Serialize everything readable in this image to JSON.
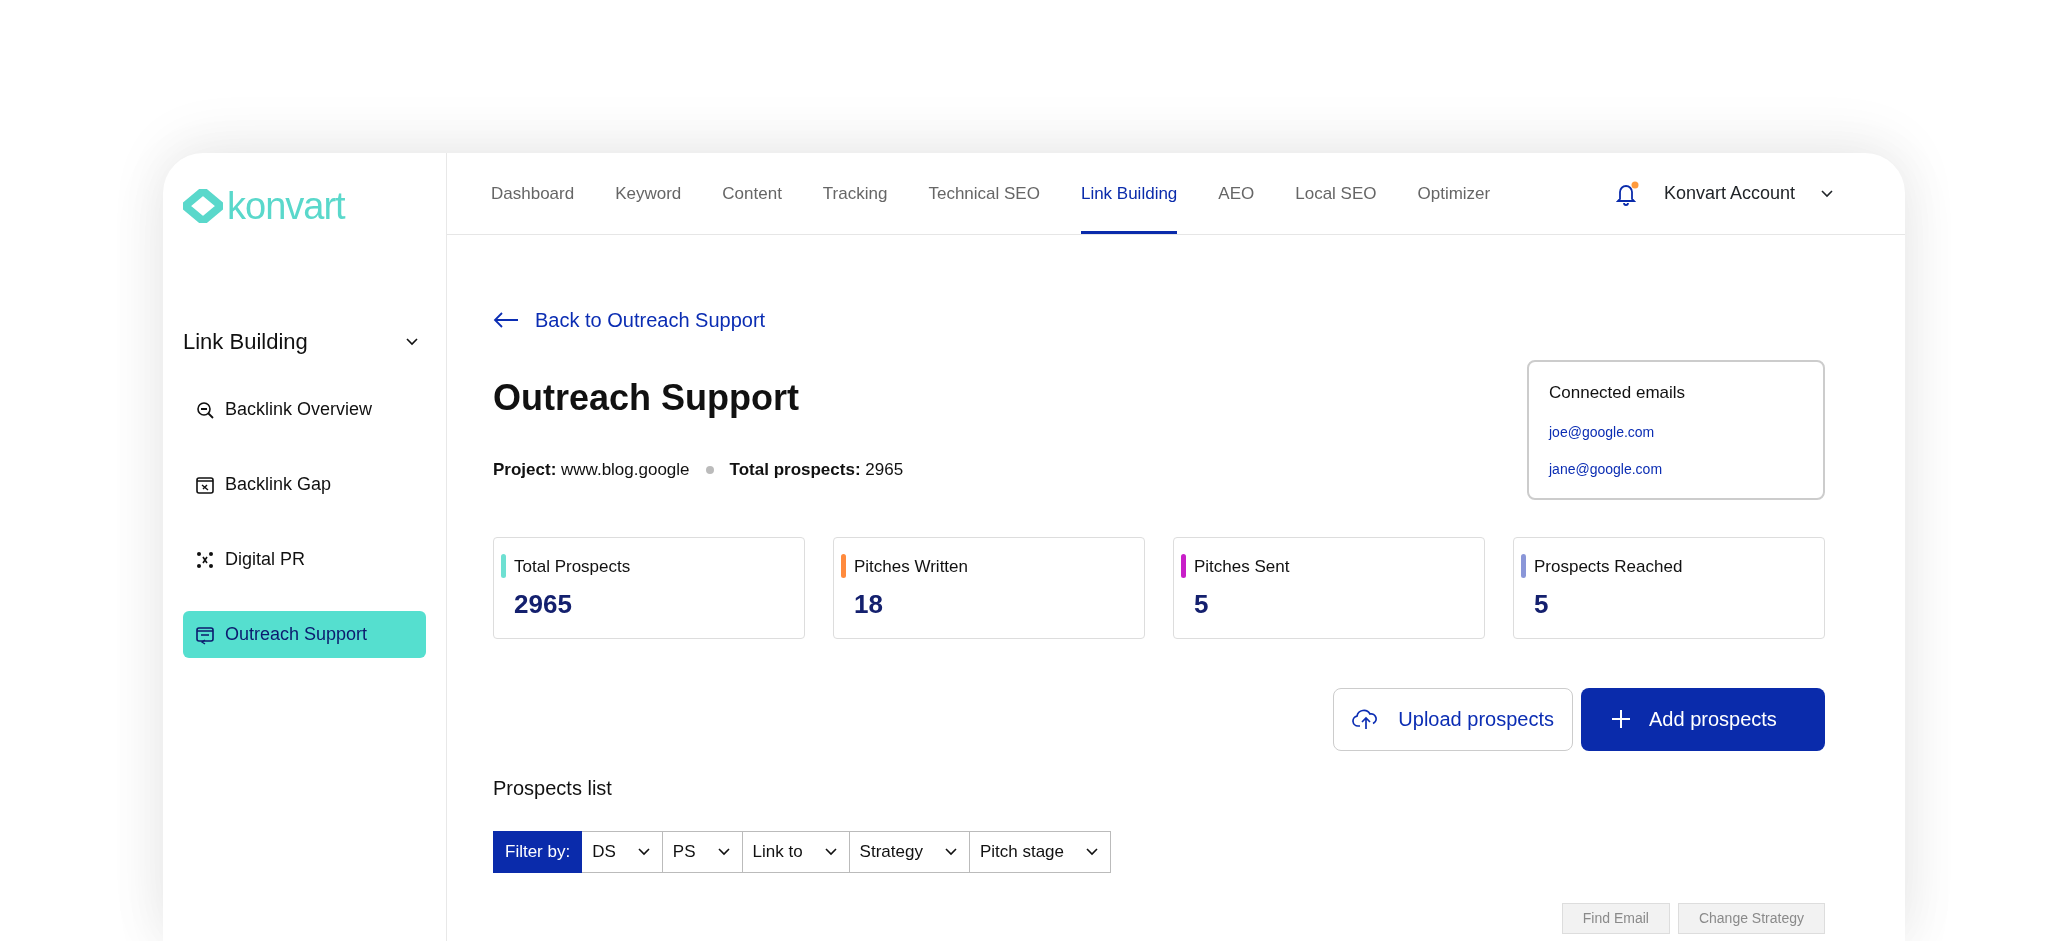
{
  "brand": {
    "name": "konvart"
  },
  "nav": {
    "tabs": [
      {
        "label": "Dashboard",
        "selected": false
      },
      {
        "label": "Keyword",
        "selected": false
      },
      {
        "label": "Content",
        "selected": false
      },
      {
        "label": "Tracking",
        "selected": false
      },
      {
        "label": "Technical SEO",
        "selected": false
      },
      {
        "label": "Link Building",
        "selected": true
      },
      {
        "label": "AEO",
        "selected": false
      },
      {
        "label": "Local SEO",
        "selected": false
      },
      {
        "label": "Optimizer",
        "selected": false
      }
    ],
    "notification": {
      "unread": true
    },
    "account": {
      "label": "Konvart Account"
    }
  },
  "sidebar": {
    "section": {
      "title": "Link Building",
      "expanded": true
    },
    "items": [
      {
        "label": "Backlink Overview",
        "selected": false
      },
      {
        "label": "Backlink Gap",
        "selected": false
      },
      {
        "label": "Digital PR",
        "selected": false
      },
      {
        "label": "Outreach Support",
        "selected": true
      }
    ]
  },
  "back_link": "Back to Outreach Support",
  "title": "Outreach Support",
  "meta": [
    {
      "label": "Project:",
      "value": "www.blog.google"
    },
    {
      "label": "Total prospects:",
      "value": "2965"
    }
  ],
  "connected_emails": {
    "title": "Connected emails",
    "emails": [
      "joe@google.com",
      "jane@google.com"
    ]
  },
  "stats": [
    {
      "label": "Total Prospects",
      "value": "2965",
      "color": "#6ee0d2"
    },
    {
      "label": "Pitches Written",
      "value": "18",
      "color": "#ff8a3d"
    },
    {
      "label": "Pitches Sent",
      "value": "5",
      "color": "#c81fc8"
    },
    {
      "label": "Prospects Reached",
      "value": "5",
      "color": "#8a96d8"
    }
  ],
  "actions": [
    {
      "kind": "upload",
      "label": "Upload prospects"
    },
    {
      "kind": "add",
      "label": "Add prospects"
    }
  ],
  "prospects": {
    "title": "Prospects list",
    "filter_label": "Filter by:",
    "filters": [
      "DS",
      "PS",
      "Link to",
      "Strategy",
      "Pitch stage"
    ],
    "bulk_actions": [
      {
        "label": "Find Email",
        "disabled": true
      },
      {
        "label": "Change Strategy",
        "disabled": true
      }
    ]
  }
}
